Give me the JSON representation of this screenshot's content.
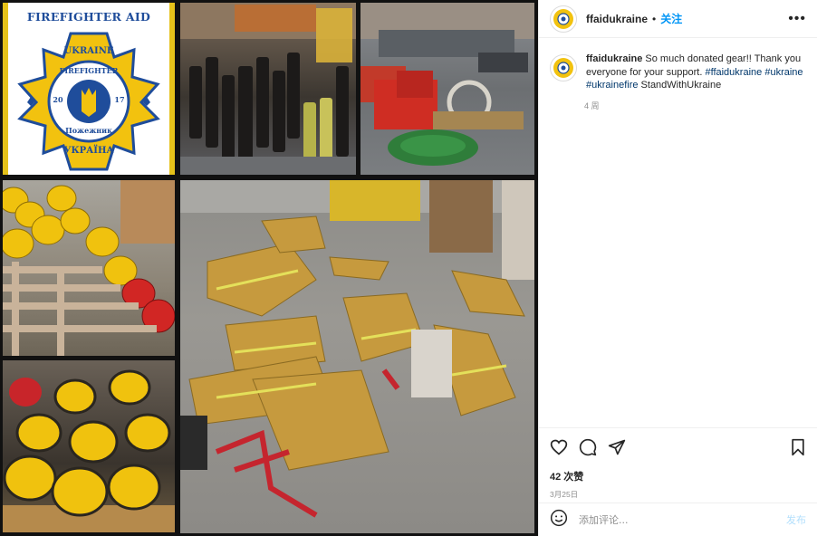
{
  "post": {
    "username": "ffaidukraine",
    "follow_separator": "•",
    "follow_label": "关注",
    "more_label": "•••",
    "caption_text": "So much donated gear!! Thank you everyone for your support.",
    "hashtags": [
      "#ffaidukraine",
      "#ukraine",
      "#ukrainefire"
    ],
    "caption_tail": "StandWithUkraine",
    "caption_age": "4 周",
    "likes": "42 次赞",
    "date": "3月25日",
    "comment_placeholder": "添加评论...",
    "post_button": "发布"
  },
  "logo": {
    "title": "FIREFIGHTER AID",
    "top_text": "UKRAINE",
    "mid_text": "FIREFIGHTER",
    "year_left": "20",
    "year_right": "17",
    "cyr1": "Пожежник",
    "cyr2": "УКРАЇНА"
  },
  "photos": [
    {
      "name": "logo"
    },
    {
      "name": "boots"
    },
    {
      "name": "equipment"
    },
    {
      "name": "helmets-pallet"
    },
    {
      "name": "turnout-gear-floor"
    },
    {
      "name": "helmets-pile"
    }
  ],
  "icons": {
    "like": "heart-icon",
    "comment": "comment-icon",
    "share": "share-icon",
    "save": "bookmark-icon",
    "emoji": "emoji-icon"
  },
  "colors": {
    "accent": "#0095f6",
    "hashtag": "#00376b",
    "logo_yellow": "#f2c20f",
    "logo_blue": "#1f4d9b"
  }
}
